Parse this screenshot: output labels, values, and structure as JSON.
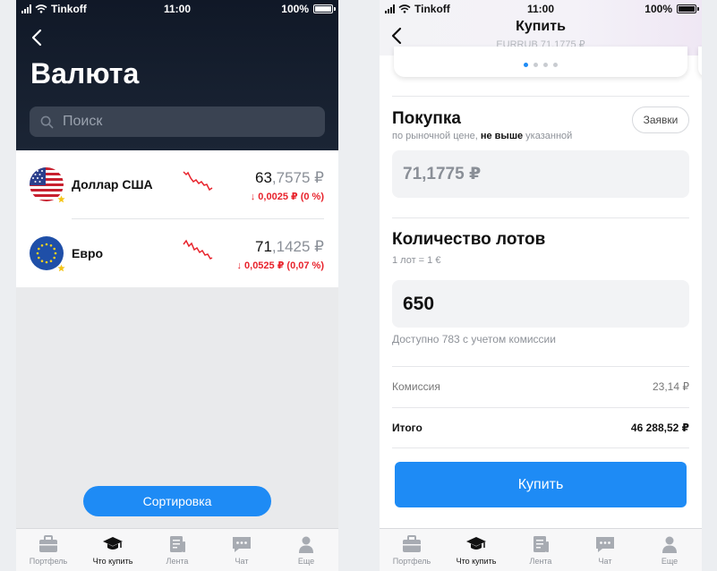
{
  "status_bar": {
    "carrier": "Tinkoff",
    "time": "11:00",
    "battery": "100%",
    "battery_level": 1.0
  },
  "left_screen": {
    "title": "Валюта",
    "search": {
      "placeholder": "Поиск",
      "value": ""
    },
    "currencies": [
      {
        "name": "Доллар США",
        "flag": "usa-flag",
        "price_main": "63",
        "price_frac": ",7575 ₽",
        "change": "0,0025 ₽ (0 %)",
        "change_direction": "down"
      },
      {
        "name": "Евро",
        "flag": "eu-flag",
        "price_main": "71",
        "price_frac": ",1425 ₽",
        "change": "0,0525 ₽ (0,07 %)",
        "change_direction": "down"
      }
    ],
    "sort_button": "Сортировка"
  },
  "right_screen": {
    "title": "Купить",
    "subtitle": "EURRUB 71,1775 ₽",
    "carousel": {
      "pages": 4,
      "active_index": 0
    },
    "purchase": {
      "title": "Покупка",
      "note_before": "по рыночной цене,",
      "note_bold": "не выше",
      "note_after": "указанной",
      "orders_button": "Заявки",
      "price_value": "71,1775 ₽"
    },
    "lots": {
      "title": "Количество лотов",
      "note": "1 лот = 1 €",
      "value": "650",
      "available": "Доступно 783 с учетом комиссии"
    },
    "commission": {
      "label": "Комиссия",
      "value": "23,14 ₽"
    },
    "total": {
      "label": "Итого",
      "value": "46 288,52 ₽"
    },
    "buy_button": "Купить"
  },
  "tabbar": {
    "items": [
      {
        "label": "Портфель",
        "icon": "briefcase-icon"
      },
      {
        "label": "Что купить",
        "icon": "graduation-cap-icon",
        "active": true
      },
      {
        "label": "Лента",
        "icon": "news-feed-icon"
      },
      {
        "label": "Чат",
        "icon": "chat-icon"
      },
      {
        "label": "Еще",
        "icon": "profile-icon"
      }
    ]
  },
  "colors": {
    "accent": "#1e8bf5",
    "negative": "#e8232c",
    "dark_header": "#141c2b"
  }
}
